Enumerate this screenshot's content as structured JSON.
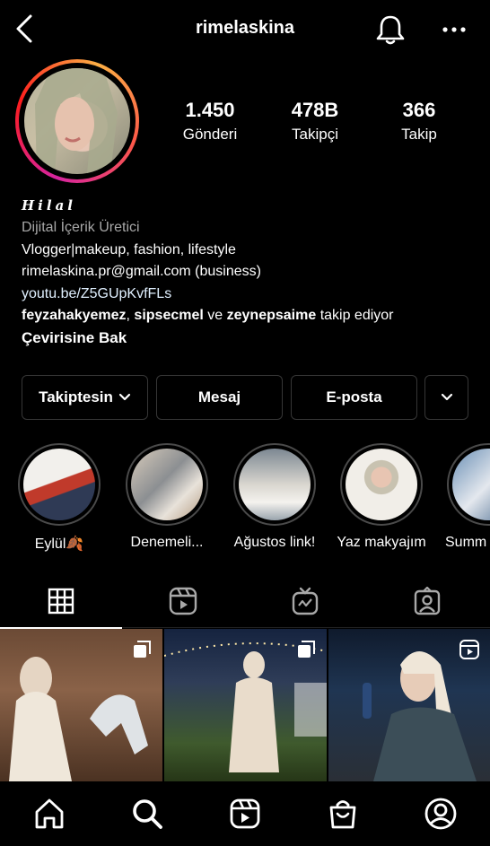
{
  "header": {
    "username": "rimelaskina",
    "back_icon": "chevron-left-icon",
    "notification_icon": "bell-icon",
    "more_icon": "more-horizontal-icon"
  },
  "stats": [
    {
      "value": "1.450",
      "label": "Gönderi"
    },
    {
      "value": "478B",
      "label": "Takipçi"
    },
    {
      "value": "366",
      "label": "Takip"
    }
  ],
  "bio": {
    "name": "Hilal",
    "category": "Dijital İçerik Üretici",
    "lines": [
      "Vlogger|makeup, fashion, lifestyle",
      "rimelaskina.pr@gmail.com (business)"
    ],
    "link": "youtu.be/Z5GUpKvfFLs",
    "followed_by": {
      "user1": "feyzahakyemez",
      "separator": ",",
      "user2": "sipsecmel",
      "and": "ve",
      "user3": "zeynepsaime",
      "suffix": "takip ediyor"
    },
    "translate": "Çevirisine Bak"
  },
  "actions": {
    "following_label": "Takiptesin",
    "message_label": "Mesaj",
    "email_label": "E-posta",
    "expand_icon": "chevron-down-icon"
  },
  "highlights": [
    {
      "label": "Eylül🍂"
    },
    {
      "label": "Denemeli..."
    },
    {
      "label": "Ağustos link!"
    },
    {
      "label": "Yaz makyajım"
    },
    {
      "label": "Summ"
    }
  ],
  "tabs": [
    {
      "name": "posts-grid",
      "icon": "grid-icon",
      "active": true
    },
    {
      "name": "reels",
      "icon": "reels-icon",
      "active": false
    },
    {
      "name": "igtv",
      "icon": "igtv-icon",
      "active": false
    },
    {
      "name": "tagged",
      "icon": "tagged-user-icon",
      "active": false
    }
  ],
  "posts": [
    {
      "badge": "carousel-icon"
    },
    {
      "badge": "carousel-icon"
    },
    {
      "badge": "reels-icon"
    }
  ],
  "bottom_nav": [
    {
      "name": "home",
      "icon": "home-icon"
    },
    {
      "name": "search",
      "icon": "search-icon"
    },
    {
      "name": "reels",
      "icon": "reels-icon"
    },
    {
      "name": "shop",
      "icon": "shopping-bag-icon"
    },
    {
      "name": "profile",
      "icon": "profile-icon"
    }
  ],
  "colors": {
    "background": "#000000",
    "text": "#ffffff",
    "secondary_text": "#a8a8a8",
    "border": "#363636",
    "story_ring_start": "#fcaf45",
    "story_ring_end": "#d6249f"
  }
}
